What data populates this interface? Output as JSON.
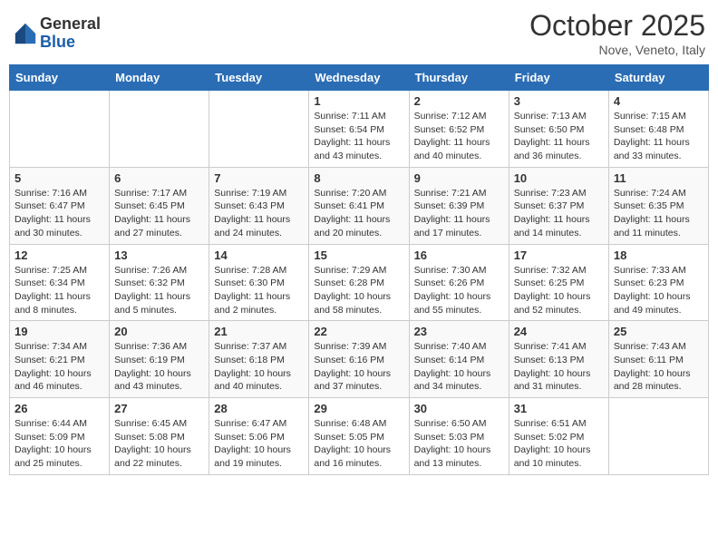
{
  "header": {
    "logo_general": "General",
    "logo_blue": "Blue",
    "month_title": "October 2025",
    "location": "Nove, Veneto, Italy"
  },
  "days_of_week": [
    "Sunday",
    "Monday",
    "Tuesday",
    "Wednesday",
    "Thursday",
    "Friday",
    "Saturday"
  ],
  "weeks": [
    [
      {
        "num": "",
        "info": ""
      },
      {
        "num": "",
        "info": ""
      },
      {
        "num": "",
        "info": ""
      },
      {
        "num": "1",
        "info": "Sunrise: 7:11 AM\nSunset: 6:54 PM\nDaylight: 11 hours and 43 minutes."
      },
      {
        "num": "2",
        "info": "Sunrise: 7:12 AM\nSunset: 6:52 PM\nDaylight: 11 hours and 40 minutes."
      },
      {
        "num": "3",
        "info": "Sunrise: 7:13 AM\nSunset: 6:50 PM\nDaylight: 11 hours and 36 minutes."
      },
      {
        "num": "4",
        "info": "Sunrise: 7:15 AM\nSunset: 6:48 PM\nDaylight: 11 hours and 33 minutes."
      }
    ],
    [
      {
        "num": "5",
        "info": "Sunrise: 7:16 AM\nSunset: 6:47 PM\nDaylight: 11 hours and 30 minutes."
      },
      {
        "num": "6",
        "info": "Sunrise: 7:17 AM\nSunset: 6:45 PM\nDaylight: 11 hours and 27 minutes."
      },
      {
        "num": "7",
        "info": "Sunrise: 7:19 AM\nSunset: 6:43 PM\nDaylight: 11 hours and 24 minutes."
      },
      {
        "num": "8",
        "info": "Sunrise: 7:20 AM\nSunset: 6:41 PM\nDaylight: 11 hours and 20 minutes."
      },
      {
        "num": "9",
        "info": "Sunrise: 7:21 AM\nSunset: 6:39 PM\nDaylight: 11 hours and 17 minutes."
      },
      {
        "num": "10",
        "info": "Sunrise: 7:23 AM\nSunset: 6:37 PM\nDaylight: 11 hours and 14 minutes."
      },
      {
        "num": "11",
        "info": "Sunrise: 7:24 AM\nSunset: 6:35 PM\nDaylight: 11 hours and 11 minutes."
      }
    ],
    [
      {
        "num": "12",
        "info": "Sunrise: 7:25 AM\nSunset: 6:34 PM\nDaylight: 11 hours and 8 minutes."
      },
      {
        "num": "13",
        "info": "Sunrise: 7:26 AM\nSunset: 6:32 PM\nDaylight: 11 hours and 5 minutes."
      },
      {
        "num": "14",
        "info": "Sunrise: 7:28 AM\nSunset: 6:30 PM\nDaylight: 11 hours and 2 minutes."
      },
      {
        "num": "15",
        "info": "Sunrise: 7:29 AM\nSunset: 6:28 PM\nDaylight: 10 hours and 58 minutes."
      },
      {
        "num": "16",
        "info": "Sunrise: 7:30 AM\nSunset: 6:26 PM\nDaylight: 10 hours and 55 minutes."
      },
      {
        "num": "17",
        "info": "Sunrise: 7:32 AM\nSunset: 6:25 PM\nDaylight: 10 hours and 52 minutes."
      },
      {
        "num": "18",
        "info": "Sunrise: 7:33 AM\nSunset: 6:23 PM\nDaylight: 10 hours and 49 minutes."
      }
    ],
    [
      {
        "num": "19",
        "info": "Sunrise: 7:34 AM\nSunset: 6:21 PM\nDaylight: 10 hours and 46 minutes."
      },
      {
        "num": "20",
        "info": "Sunrise: 7:36 AM\nSunset: 6:19 PM\nDaylight: 10 hours and 43 minutes."
      },
      {
        "num": "21",
        "info": "Sunrise: 7:37 AM\nSunset: 6:18 PM\nDaylight: 10 hours and 40 minutes."
      },
      {
        "num": "22",
        "info": "Sunrise: 7:39 AM\nSunset: 6:16 PM\nDaylight: 10 hours and 37 minutes."
      },
      {
        "num": "23",
        "info": "Sunrise: 7:40 AM\nSunset: 6:14 PM\nDaylight: 10 hours and 34 minutes."
      },
      {
        "num": "24",
        "info": "Sunrise: 7:41 AM\nSunset: 6:13 PM\nDaylight: 10 hours and 31 minutes."
      },
      {
        "num": "25",
        "info": "Sunrise: 7:43 AM\nSunset: 6:11 PM\nDaylight: 10 hours and 28 minutes."
      }
    ],
    [
      {
        "num": "26",
        "info": "Sunrise: 6:44 AM\nSunset: 5:09 PM\nDaylight: 10 hours and 25 minutes."
      },
      {
        "num": "27",
        "info": "Sunrise: 6:45 AM\nSunset: 5:08 PM\nDaylight: 10 hours and 22 minutes."
      },
      {
        "num": "28",
        "info": "Sunrise: 6:47 AM\nSunset: 5:06 PM\nDaylight: 10 hours and 19 minutes."
      },
      {
        "num": "29",
        "info": "Sunrise: 6:48 AM\nSunset: 5:05 PM\nDaylight: 10 hours and 16 minutes."
      },
      {
        "num": "30",
        "info": "Sunrise: 6:50 AM\nSunset: 5:03 PM\nDaylight: 10 hours and 13 minutes."
      },
      {
        "num": "31",
        "info": "Sunrise: 6:51 AM\nSunset: 5:02 PM\nDaylight: 10 hours and 10 minutes."
      },
      {
        "num": "",
        "info": ""
      }
    ]
  ]
}
